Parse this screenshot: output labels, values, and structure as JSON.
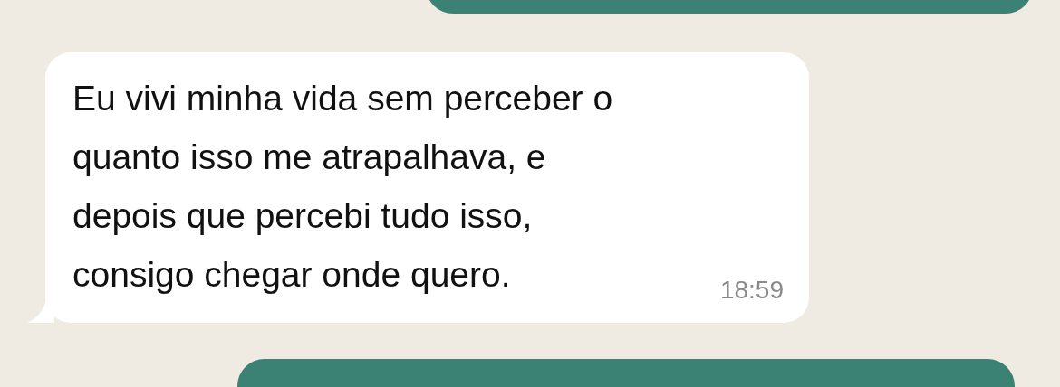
{
  "messages": [
    {
      "kind": "outgoing"
    },
    {
      "kind": "incoming",
      "text": "Eu vivi minha vida sem perceber o\nquanto isso me atrapalhava, e\ndepois que percebi tudo isso,\nconsigo chegar onde quero.",
      "time": "18:59"
    },
    {
      "kind": "outgoing"
    }
  ]
}
